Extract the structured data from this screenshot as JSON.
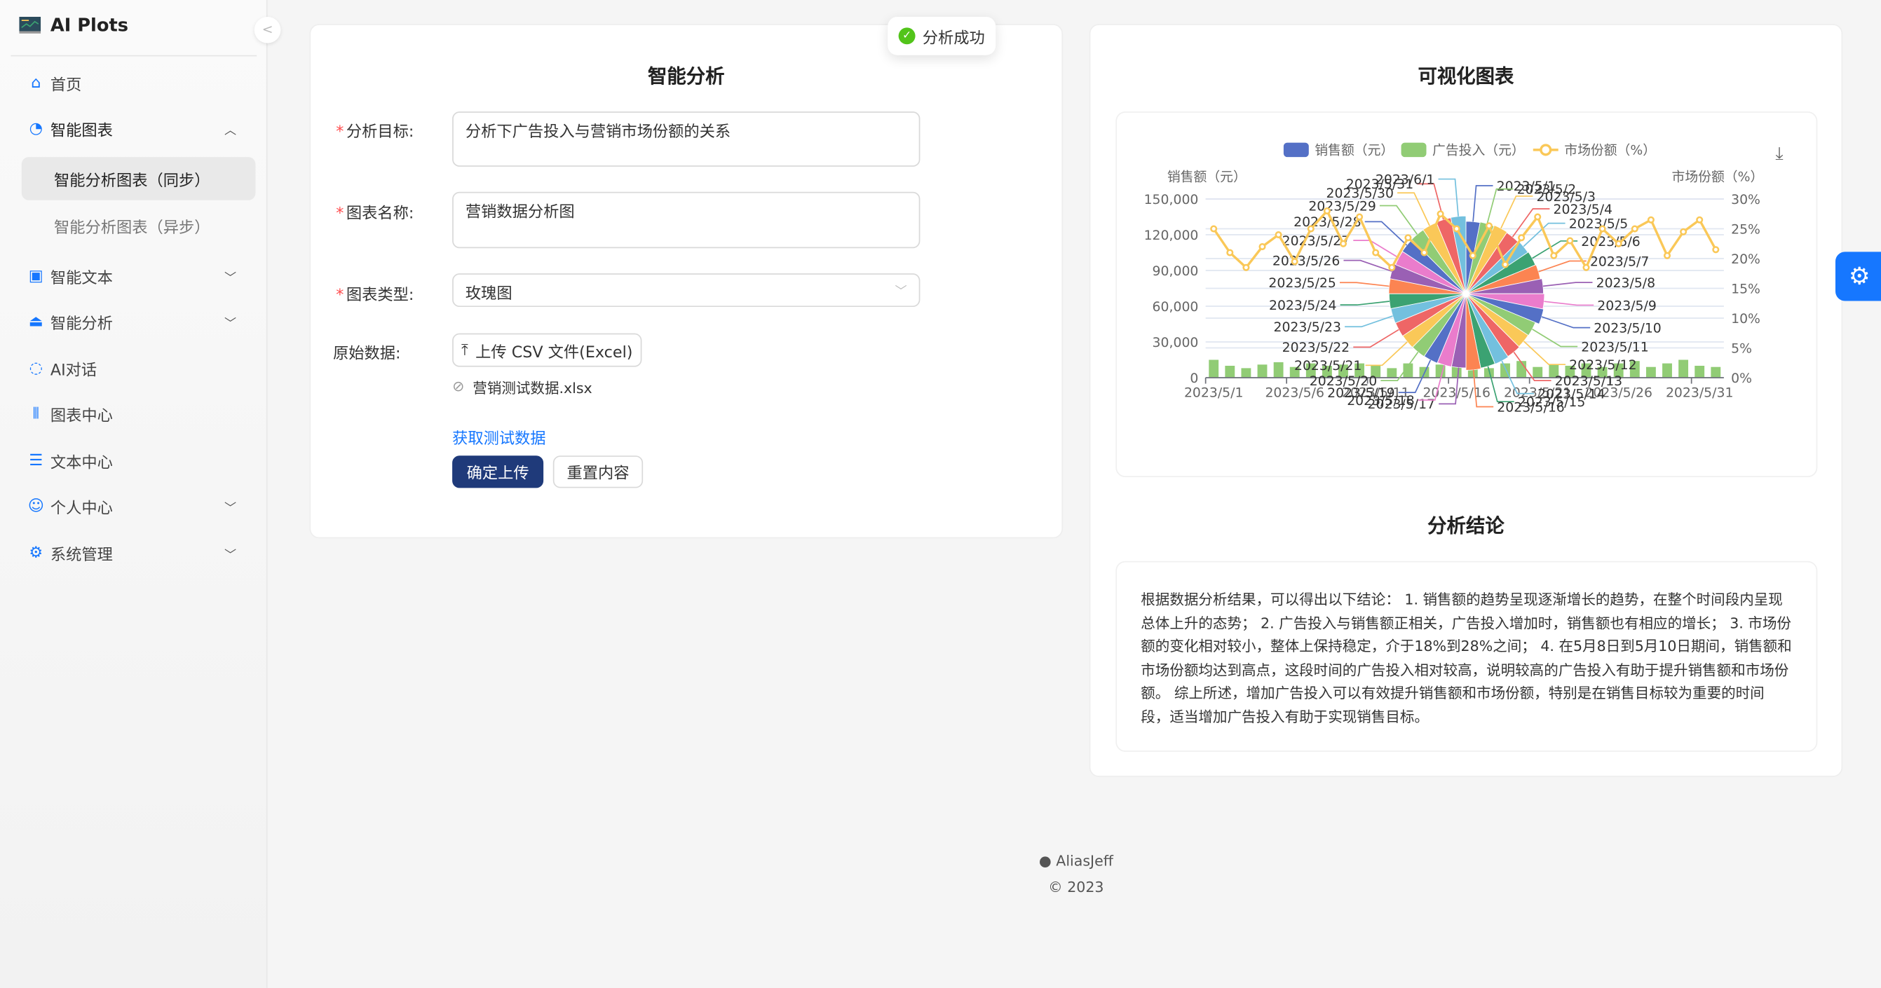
{
  "app": {
    "title": "AI Plots"
  },
  "sidebar": {
    "items": [
      {
        "label": "首页",
        "icon": "home-icon"
      },
      {
        "label": "智能图表",
        "icon": "pie-chart-icon",
        "expanded": true,
        "children": [
          {
            "label": "智能分析图表（同步）",
            "active": true
          },
          {
            "label": "智能分析图表（异步）"
          }
        ]
      },
      {
        "label": "智能文本",
        "icon": "file-markdown-icon"
      },
      {
        "label": "智能分析",
        "icon": "alarm-icon"
      },
      {
        "label": "AI对话",
        "icon": "message-icon"
      },
      {
        "label": "图表中心",
        "icon": "sliders-icon"
      },
      {
        "label": "文本中心",
        "icon": "list-icon"
      },
      {
        "label": "个人中心",
        "icon": "smile-icon"
      },
      {
        "label": "系统管理",
        "icon": "setting-icon"
      }
    ]
  },
  "toast": {
    "text": "分析成功"
  },
  "form": {
    "title": "智能分析",
    "goal_label": "分析目标:",
    "goal_value": "分析下广告投入与营销市场份额的关系",
    "name_label": "图表名称:",
    "name_value": "营销数据分析图",
    "type_label": "图表类型:",
    "type_value": "玫瑰图",
    "data_label": "原始数据:",
    "upload_label": "上传 CSV 文件(Excel)",
    "file_name": "营销测试数据.xlsx",
    "test_link": "获取测试数据",
    "submit": "确定上传",
    "reset": "重置内容"
  },
  "chart_panel": {
    "title": "可视化图表"
  },
  "conclusion": {
    "title": "分析结论",
    "text": "根据数据分析结果，可以得出以下结论： 1. 销售额的趋势呈现逐渐增长的趋势，在整个时间段内呈现总体上升的态势； 2. 广告投入与销售额正相关，广告投入增加时，销售额也有相应的增长； 3. 市场份额的变化相对较小，整体上保持稳定，介于18%到28%之间； 4. 在5月8日到5月10日期间，销售额和市场份额均达到高点，这段时间的广告投入相对较高，说明较高的广告投入有助于提升销售额和市场份额。 综上所述，增加广告投入可以有效提升销售额和市场份额，特别是在销售目标较为重要的时间段，适当增加广告投入有助于实现销售目标。"
  },
  "footer": {
    "author": "AliasJeff",
    "copyright": "© 2023"
  },
  "chart_data": {
    "type": "bar",
    "legend": [
      "销售额（元）",
      "广告投入（元）",
      "市场份额（%）"
    ],
    "legend_position": "top",
    "ylabel_left": "销售额（元）",
    "ylabel_right": "市场份额（%）",
    "yticks_left": [
      "0",
      "30,000",
      "60,000",
      "90,000",
      "120,000",
      "150,000"
    ],
    "yticks_right": [
      "0%",
      "5%",
      "10%",
      "15%",
      "20%",
      "25%",
      "30%"
    ],
    "ylim_left": [
      0,
      150000
    ],
    "ylim_right": [
      0,
      30
    ],
    "xticks": [
      "2023/5/1",
      "2023/5/6",
      "2023/5/11",
      "2023/5/16",
      "2023/5/21",
      "2023/5/26",
      "2023/5/31"
    ],
    "categories": [
      "2023/5/1",
      "2023/5/2",
      "2023/5/3",
      "2023/5/4",
      "2023/5/5",
      "2023/5/6",
      "2023/5/7",
      "2023/5/8",
      "2023/5/9",
      "2023/5/10",
      "2023/5/11",
      "2023/5/12",
      "2023/5/13",
      "2023/5/14",
      "2023/5/15",
      "2023/5/16",
      "2023/5/17",
      "2023/5/18",
      "2023/5/19",
      "2023/5/20",
      "2023/5/21",
      "2023/5/22",
      "2023/5/23",
      "2023/5/24",
      "2023/5/25",
      "2023/5/26",
      "2023/5/27",
      "2023/5/28",
      "2023/5/29",
      "2023/5/30",
      "2023/5/31",
      "2023/6/1"
    ],
    "series": [
      {
        "name": "销售额（元）",
        "type": "rose",
        "values": [
          110000,
          112000,
          115000,
          113000,
          116000,
          118000,
          120000,
          125000,
          128000,
          130000,
          118000,
          117000,
          119000,
          121000,
          120000,
          122000,
          115000,
          116000,
          118000,
          119000,
          120000,
          121000,
          122000,
          123000,
          124000,
          125000,
          121000,
          122000,
          123000,
          124000,
          125000,
          126000
        ]
      },
      {
        "name": "广告投入（元）",
        "type": "bar",
        "values": [
          15000,
          10000,
          8000,
          11000,
          13000,
          9000,
          12000,
          10000,
          11000,
          12000,
          10000,
          8000,
          12000,
          9000,
          11000,
          10000,
          13000,
          8000,
          12000,
          14000,
          9000,
          11000,
          10000,
          12000,
          9000,
          12000,
          14000,
          9000,
          12000,
          15000,
          10000,
          9000
        ]
      },
      {
        "name": "市场份额（%）",
        "type": "line",
        "values": [
          25,
          21,
          18.5,
          22,
          24,
          19.5,
          25,
          28,
          22.5,
          27,
          21,
          18.5,
          23.5,
          21,
          27.5,
          25,
          20.5,
          25.5,
          19,
          23.5,
          27,
          20.5,
          23,
          18.5,
          25,
          22.5,
          25,
          26.5,
          20.5,
          24.5,
          26.5,
          21.5
        ]
      }
    ],
    "colors": [
      "#5470c6",
      "#91cc75",
      "#fac858",
      "#ee6666",
      "#73c0de",
      "#3ba272",
      "#fc8452",
      "#9a60b4",
      "#ea7ccc"
    ]
  }
}
